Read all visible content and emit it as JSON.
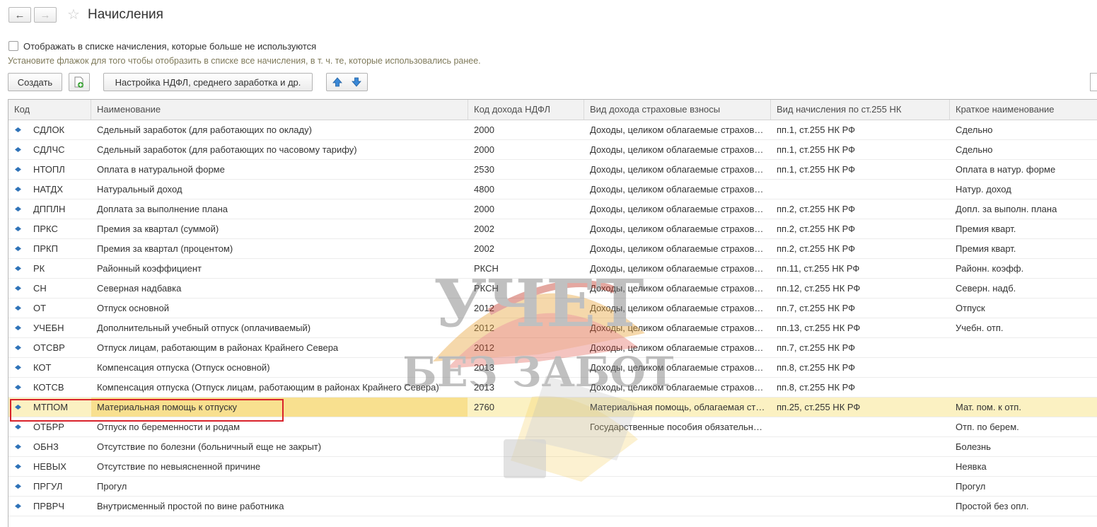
{
  "window": {
    "title": "Начисления"
  },
  "options": {
    "show_unused_label": "Отображать в списке начисления, которые больше не используются",
    "hint": "Установите флажок для того чтобы отобразить в списке все начисления, в т. ч. те, которые использовались ранее."
  },
  "toolbar": {
    "create_label": "Создать",
    "ndfl_settings_label": "Настройка НДФЛ, среднего заработка и др."
  },
  "table": {
    "columns": [
      "Код",
      "Наименование",
      "Код дохода НДФЛ",
      "Вид дохода страховые взносы",
      "Вид начисления по ст.255 НК",
      "Краткое наименование"
    ],
    "rows": [
      {
        "code": "СДЛОК",
        "name": "Сдельный заработок (для работающих по окладу)",
        "ndfl": "2000",
        "ins": "Доходы, целиком облагаемые страховыми взносами",
        "art": "пп.1, ст.255 НК РФ",
        "short": "Сдельно"
      },
      {
        "code": "СДЛЧС",
        "name": "Сдельный заработок (для работающих по часовому тарифу)",
        "ndfl": "2000",
        "ins": "Доходы, целиком облагаемые страховыми взносами",
        "art": "пп.1, ст.255 НК РФ",
        "short": "Сдельно"
      },
      {
        "code": "НТОПЛ",
        "name": "Оплата в натуральной форме",
        "ndfl": "2530",
        "ins": "Доходы, целиком облагаемые страховыми взносами",
        "art": "пп.1, ст.255 НК РФ",
        "short": "Оплата в натур. форме"
      },
      {
        "code": "НАТДХ",
        "name": "Натуральный доход",
        "ndfl": "4800",
        "ins": "Доходы, целиком облагаемые страховыми взносами",
        "art": "",
        "short": "Натур. доход"
      },
      {
        "code": "ДППЛН",
        "name": "Доплата за выполнение плана",
        "ndfl": "2000",
        "ins": "Доходы, целиком облагаемые страховыми взносами",
        "art": "пп.2, ст.255 НК РФ",
        "short": "Допл. за выполн. плана"
      },
      {
        "code": "ПРКС",
        "name": "Премия за квартал (суммой)",
        "ndfl": "2002",
        "ins": "Доходы, целиком облагаемые страховыми взносами",
        "art": "пп.2, ст.255 НК РФ",
        "short": "Премия кварт."
      },
      {
        "code": "ПРКП",
        "name": "Премия за квартал (процентом)",
        "ndfl": "2002",
        "ins": "Доходы, целиком облагаемые страховыми взносами",
        "art": "пп.2, ст.255 НК РФ",
        "short": "Премия кварт."
      },
      {
        "code": "РК",
        "name": "Районный коэффициент",
        "ndfl": "РКСН",
        "ins": "Доходы, целиком облагаемые страховыми взносами",
        "art": "пп.11, ст.255 НК РФ",
        "short": "Районн. коэфф."
      },
      {
        "code": "СН",
        "name": "Северная надбавка",
        "ndfl": "РКСН",
        "ins": "Доходы, целиком облагаемые страховыми взносами",
        "art": "пп.12, ст.255 НК РФ",
        "short": "Северн. надб."
      },
      {
        "code": "ОТ",
        "name": "Отпуск основной",
        "ndfl": "2012",
        "ins": "Доходы, целиком облагаемые страховыми взносами",
        "art": "пп.7, ст.255 НК РФ",
        "short": "Отпуск"
      },
      {
        "code": "УЧЕБН",
        "name": "Дополнительный учебный отпуск (оплачиваемый)",
        "ndfl": "2012",
        "ins": "Доходы, целиком облагаемые страховыми взносами",
        "art": "пп.13, ст.255 НК РФ",
        "short": "Учебн. отп."
      },
      {
        "code": "ОТСВР",
        "name": "Отпуск лицам, работающим в районах Крайнего Севера",
        "ndfl": "2012",
        "ins": "Доходы, целиком облагаемые страховыми взносами",
        "art": "пп.7, ст.255 НК РФ",
        "short": ""
      },
      {
        "code": "КОТ",
        "name": "Компенсация отпуска (Отпуск основной)",
        "ndfl": "2013",
        "ins": "Доходы, целиком облагаемые страховыми взносами",
        "art": "пп.8, ст.255 НК РФ",
        "short": ""
      },
      {
        "code": "КОТСВ",
        "name": "Компенсация отпуска (Отпуск лицам, работающим в районах Крайнего Севера)",
        "ndfl": "2013",
        "ins": "Доходы, целиком облагаемые страховыми взносами",
        "art": "пп.8, ст.255 НК РФ",
        "short": ""
      },
      {
        "code": "МТПОМ",
        "name": "Материальная помощь к отпуску",
        "ndfl": "2760",
        "ins": "Материальная помощь, облагаемая страховыми взносами",
        "art": "пп.25, ст.255 НК РФ",
        "short": "Мат. пом. к отп."
      },
      {
        "code": "ОТБРР",
        "name": "Отпуск по беременности и родам",
        "ndfl": "",
        "ins": "Государственные пособия обязательного страхования",
        "art": "",
        "short": "Отп. по берем."
      },
      {
        "code": "ОБНЗ",
        "name": "Отсутствие по болезни (больничный еще не закрыт)",
        "ndfl": "",
        "ins": "",
        "art": "",
        "short": "Болезнь"
      },
      {
        "code": "НЕВЫХ",
        "name": "Отсутствие по невыясненной причине",
        "ndfl": "",
        "ins": "",
        "art": "",
        "short": "Неявка"
      },
      {
        "code": "ПРГУЛ",
        "name": "Прогул",
        "ndfl": "",
        "ins": "",
        "art": "",
        "short": "Прогул"
      },
      {
        "code": "ПРВРЧ",
        "name": "Внутрисменный простой по вине работника",
        "ndfl": "",
        "ins": "",
        "art": "",
        "short": "Простой без опл."
      }
    ],
    "selected_row_index": 14
  },
  "watermark": {
    "line1": "УЧЕТ",
    "line2": "БЕЗ ЗАБОТ"
  },
  "colors": {
    "selected_row": "#fbf1c2",
    "selected_cell": "#f8e08f",
    "highlight_frame": "#d9232b",
    "row_marker": "#2f73b8"
  }
}
